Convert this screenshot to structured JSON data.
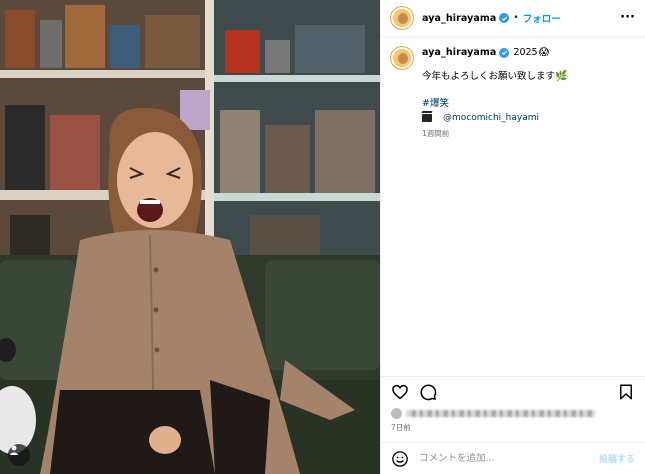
{
  "header": {
    "username": "aya_hirayama",
    "dot": "•",
    "follow_label": "フォロー",
    "more_label": "···"
  },
  "caption": {
    "username": "aya_hirayama",
    "year": "2025",
    "year_emoji": "😱",
    "text": "今年もよろしくお願い致します",
    "leaf_emoji": "🌿",
    "hashtag": "#爆笑",
    "mention": "@mocomichi_hayami",
    "time_ago": "1週間前"
  },
  "post": {
    "date": "7日前"
  },
  "comment": {
    "placeholder": "コメントを追加...",
    "post_label": "投稿する"
  },
  "colors": {
    "accent": "#0095f6",
    "verified": "#3897f0",
    "link": "#00376b",
    "muted": "#737373"
  },
  "icons": {
    "heart": "heart-icon",
    "comment": "comment-icon",
    "bookmark": "bookmark-icon",
    "emoji": "smile-icon",
    "verified": "verified-badge-icon",
    "more": "more-icon",
    "clapper": "clapper-board-icon",
    "user": "user-tag-icon"
  }
}
